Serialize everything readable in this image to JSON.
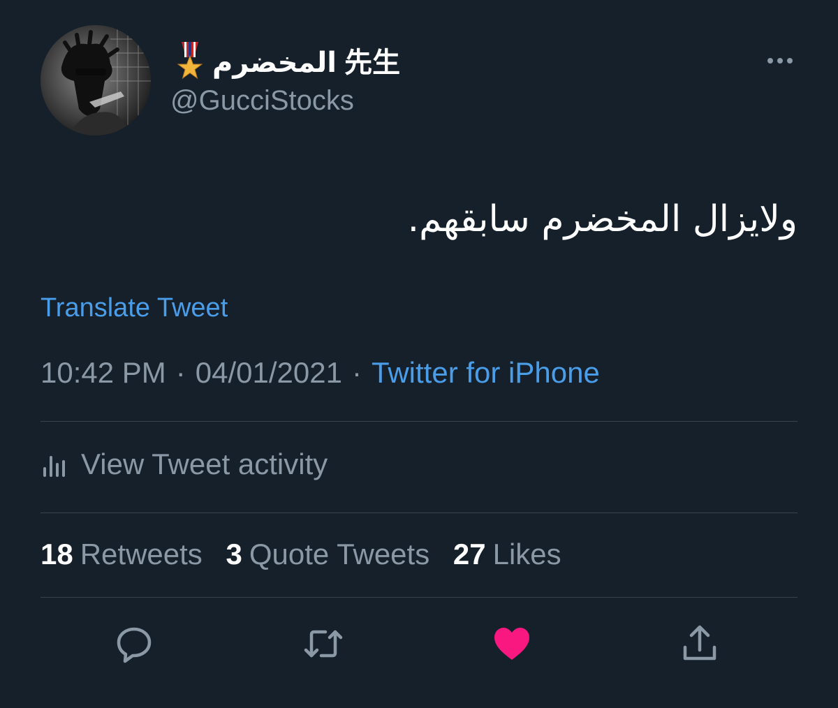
{
  "tweet": {
    "display_name": "المخضرم 先生",
    "username": "@GucciStocks",
    "text": "ولايزال المخضرم سابقهم.",
    "translate_label": "Translate Tweet",
    "time": "10:42 PM",
    "date": "04/01/2021",
    "separator": "·",
    "source": "Twitter for iPhone"
  },
  "activity": {
    "label": "View Tweet activity"
  },
  "stats": {
    "retweets_count": "18",
    "retweets_label": "Retweets",
    "quotes_count": "3",
    "quotes_label": "Quote Tweets",
    "likes_count": "27",
    "likes_label": "Likes"
  },
  "icons": {
    "medal": "medal-icon",
    "more": "more-icon",
    "activity": "bar-chart-icon",
    "reply": "reply-icon",
    "retweet": "retweet-icon",
    "like": "heart-icon",
    "share": "share-icon"
  },
  "colors": {
    "background": "#15202b",
    "link": "#4a9de8",
    "secondary_text": "#8b98a5",
    "like": "#f91880",
    "divider": "#38444d"
  }
}
